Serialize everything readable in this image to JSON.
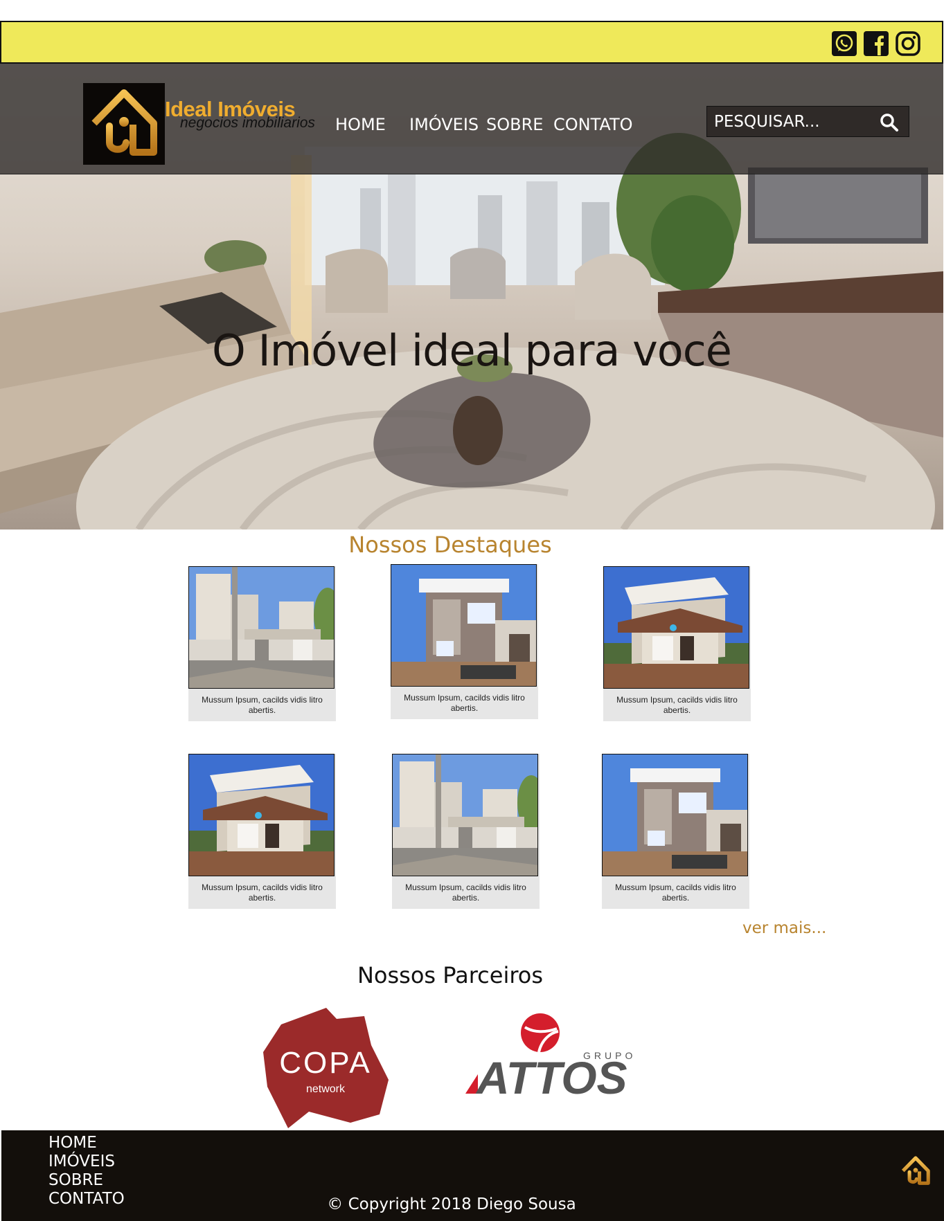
{
  "social": {
    "icons": [
      "whatsapp-icon",
      "facebook-icon",
      "instagram-icon"
    ]
  },
  "header": {
    "logo_name": "Ideal Imóveis",
    "logo_slogan": "negocios imobiliarios",
    "menu": [
      "HOME",
      "IMÓVEIS",
      "SOBRE",
      "CONTATO"
    ],
    "search_placeholder": "PESQUISAR..."
  },
  "hero": {
    "title": "O Imóvel ideal para você"
  },
  "featured": {
    "title": "Nossos Destaques",
    "cards": [
      {
        "caption": "Mussum Ipsum, cacilds vidis litro abertis.",
        "photo": "condo-gate"
      },
      {
        "caption": "Mussum Ipsum, cacilds vidis litro abertis.",
        "photo": "house-modern"
      },
      {
        "caption": "Mussum Ipsum, cacilds vidis litro abertis.",
        "photo": "house-roof"
      },
      {
        "caption": "Mussum Ipsum, cacilds vidis litro abertis.",
        "photo": "house-roof"
      },
      {
        "caption": "Mussum Ipsum, cacilds vidis litro abertis.",
        "photo": "condo-gate"
      },
      {
        "caption": "Mussum Ipsum, cacilds vidis litro abertis.",
        "photo": "house-modern"
      }
    ],
    "see_more": "ver mais..."
  },
  "partners": {
    "title": "Nossos Parceiros",
    "copa_main": "COPA",
    "copa_sub": "network",
    "attos_main": "ATTOS",
    "attos_sub": "GRUPO"
  },
  "footer": {
    "links": [
      "HOME",
      "IMÓVEIS",
      "SOBRE",
      "CONTATO"
    ],
    "copyright": "© Copyright 2018 Diego Sousa"
  },
  "colors": {
    "social_bar": "#efe95a",
    "accent": "#b8842f",
    "logo_gold": "#f0ad2f",
    "footer_bg": "#130f0b"
  }
}
